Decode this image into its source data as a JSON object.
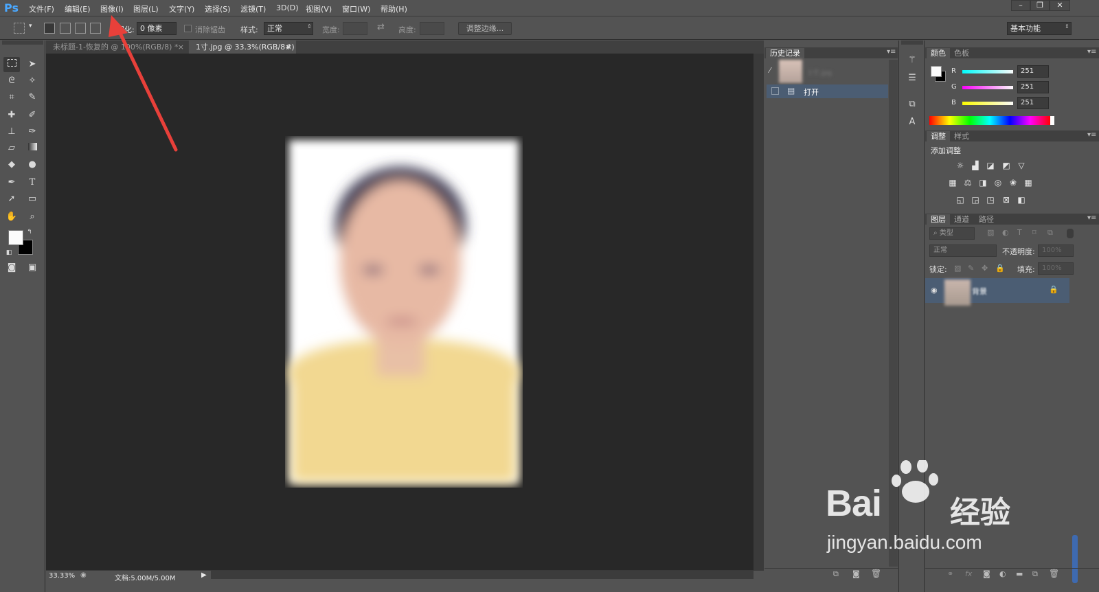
{
  "menubar": {
    "logo": "Ps",
    "items": [
      "文件(F)",
      "编辑(E)",
      "图像(I)",
      "图层(L)",
      "文字(Y)",
      "选择(S)",
      "滤镜(T)",
      "3D(D)",
      "视图(V)",
      "窗口(W)",
      "帮助(H)"
    ],
    "window_controls": [
      "–",
      "❐",
      "✕"
    ]
  },
  "options": {
    "feather_label": "羽化:",
    "feather_value": "0 像素",
    "antialias_label": "消除锯齿",
    "style_label": "样式:",
    "style_value": "正常",
    "width_label": "宽度:",
    "height_label": "高度:",
    "refine_edge": "调整边缘...",
    "workspace": "基本功能"
  },
  "tabs": [
    {
      "label": "未标题-1-恢复的 @ 100%(RGB/8) *",
      "close": "×"
    },
    {
      "label": "1寸.jpg @ 33.3%(RGB/8#)",
      "close": "×"
    }
  ],
  "status": {
    "zoom": "33.33%",
    "doc_info": "文档:5.00M/5.00M"
  },
  "history": {
    "tab": "历史记录",
    "snapshot_name": "1寸.jpg",
    "items": [
      {
        "label": "打开"
      }
    ]
  },
  "color_panel": {
    "tabs": [
      "颜色",
      "色板"
    ],
    "r_label": "R",
    "r": "251",
    "g_label": "G",
    "g": "251",
    "b_label": "B",
    "b": "251"
  },
  "adjustments": {
    "tabs": [
      "调整",
      "样式"
    ],
    "title": "添加调整"
  },
  "layers": {
    "tabs": [
      "图层",
      "通道",
      "路径"
    ],
    "filter": "类型",
    "blend_mode": "正常",
    "opacity_label": "不透明度:",
    "opacity": "100%",
    "lock_label": "锁定:",
    "fill_label": "填充:",
    "fill": "100%",
    "layer_name": "背景"
  },
  "watermark": {
    "brand": "Bai",
    "brand_cn": "经验",
    "url": "jingyan.baidu.com"
  },
  "colors": {
    "accent": "#4aa8ff",
    "arrow": "#e8403a",
    "canvas": "#282828",
    "selected": "#4b5d73"
  }
}
